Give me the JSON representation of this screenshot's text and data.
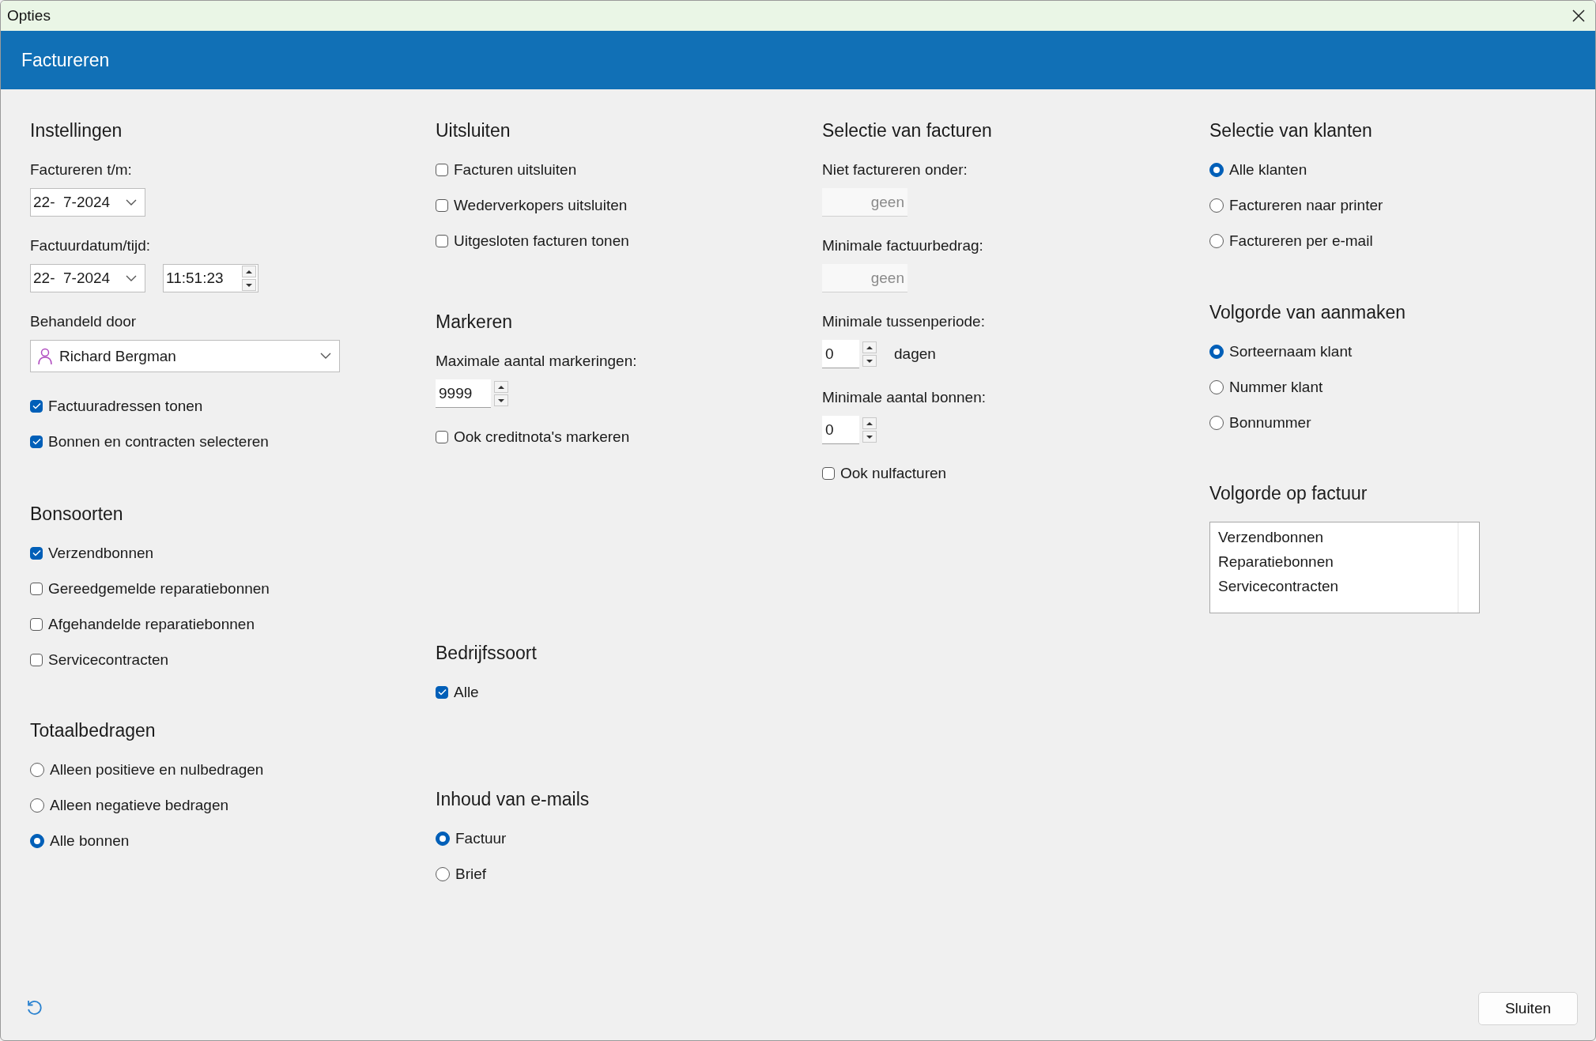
{
  "window": {
    "title": "Opties"
  },
  "header": {
    "title": "Factureren"
  },
  "columns": [
    [
      {
        "heading": "Instellingen",
        "items": [
          {
            "kind": "label",
            "text": "Factureren t/m:"
          },
          {
            "kind": "date",
            "value": "22-  7-2024"
          },
          {
            "kind": "label",
            "text": "Factuurdatum/tijd:"
          },
          {
            "kind": "datetime",
            "value": "22-  7-2024",
            "time": "11:51:23"
          },
          {
            "kind": "label",
            "text": "Behandeld door"
          },
          {
            "kind": "person",
            "value": "Richard Bergman"
          },
          {
            "kind": "checkbox",
            "label": "Factuuradressen tonen",
            "checked": true
          },
          {
            "kind": "checkbox",
            "label": "Bonnen en contracten selecteren",
            "checked": true
          }
        ]
      },
      {
        "heading": "Bonsoorten",
        "items": [
          {
            "kind": "checkbox",
            "label": "Verzendbonnen",
            "checked": true
          },
          {
            "kind": "checkbox",
            "label": "Gereedgemelde reparatiebonnen",
            "checked": false
          },
          {
            "kind": "checkbox",
            "label": "Afgehandelde reparatiebonnen",
            "checked": false
          },
          {
            "kind": "checkbox",
            "label": "Servicecontracten",
            "checked": false
          }
        ]
      },
      {
        "heading": "Totaalbedragen",
        "items": [
          {
            "kind": "radio",
            "label": "Alleen positieve en nulbedragen",
            "selected": false
          },
          {
            "kind": "radio",
            "label": "Alleen negatieve bedragen",
            "selected": false
          },
          {
            "kind": "radio",
            "label": "Alle bonnen",
            "selected": true
          }
        ]
      }
    ],
    [
      {
        "heading": "Uitsluiten",
        "items": [
          {
            "kind": "checkbox",
            "label": "Facturen uitsluiten",
            "checked": false
          },
          {
            "kind": "checkbox",
            "label": "Wederverkopers uitsluiten",
            "checked": false
          },
          {
            "kind": "checkbox",
            "label": "Uitgesloten facturen tonen",
            "checked": false
          }
        ]
      },
      {
        "heading": "Markeren",
        "items": [
          {
            "kind": "label",
            "text": "Maximale aantal markeringen:"
          },
          {
            "kind": "spin",
            "value": "9999"
          },
          {
            "kind": "checkbox",
            "label": "Ook creditnota's markeren",
            "checked": false
          }
        ]
      },
      {
        "heading": "Bedrijfssoort",
        "items": [
          {
            "kind": "checkbox",
            "label": "Alle",
            "checked": true
          }
        ]
      },
      {
        "heading": "Inhoud van e-mails",
        "items": [
          {
            "kind": "radio",
            "label": "Factuur",
            "selected": true
          },
          {
            "kind": "radio",
            "label": "Brief",
            "selected": false
          }
        ]
      }
    ],
    [
      {
        "heading": "Selectie van facturen",
        "items": [
          {
            "kind": "label",
            "text": "Niet factureren onder:"
          },
          {
            "kind": "amount",
            "value": "geen",
            "disabled": true
          },
          {
            "kind": "label",
            "text": "Minimale factuurbedrag:"
          },
          {
            "kind": "amount",
            "value": "geen",
            "disabled": true
          },
          {
            "kind": "label",
            "text": "Minimale tussenperiode:"
          },
          {
            "kind": "spin",
            "value": "0",
            "unit": "dagen"
          },
          {
            "kind": "label",
            "text": "Minimale aantal bonnen:"
          },
          {
            "kind": "spin",
            "value": "0"
          },
          {
            "kind": "checkbox",
            "label": "Ook nulfacturen",
            "checked": false
          }
        ]
      }
    ],
    [
      {
        "heading": "Selectie van klanten",
        "items": [
          {
            "kind": "radio",
            "label": "Alle klanten",
            "selected": true
          },
          {
            "kind": "radio",
            "label": "Factureren naar printer",
            "selected": false
          },
          {
            "kind": "radio",
            "label": "Factureren per e-mail",
            "selected": false
          }
        ]
      },
      {
        "heading": "Volgorde van aanmaken",
        "items": [
          {
            "kind": "radio",
            "label": "Sorteernaam klant",
            "selected": true
          },
          {
            "kind": "radio",
            "label": "Nummer klant",
            "selected": false
          },
          {
            "kind": "radio",
            "label": "Bonnummer",
            "selected": false
          }
        ]
      },
      {
        "heading": "Volgorde op factuur",
        "items": [
          {
            "kind": "list",
            "entries": [
              "Verzendbonnen",
              "Reparatiebonnen",
              "Servicecontracten"
            ]
          }
        ]
      }
    ]
  ],
  "footer": {
    "close_button": "Sluiten"
  }
}
